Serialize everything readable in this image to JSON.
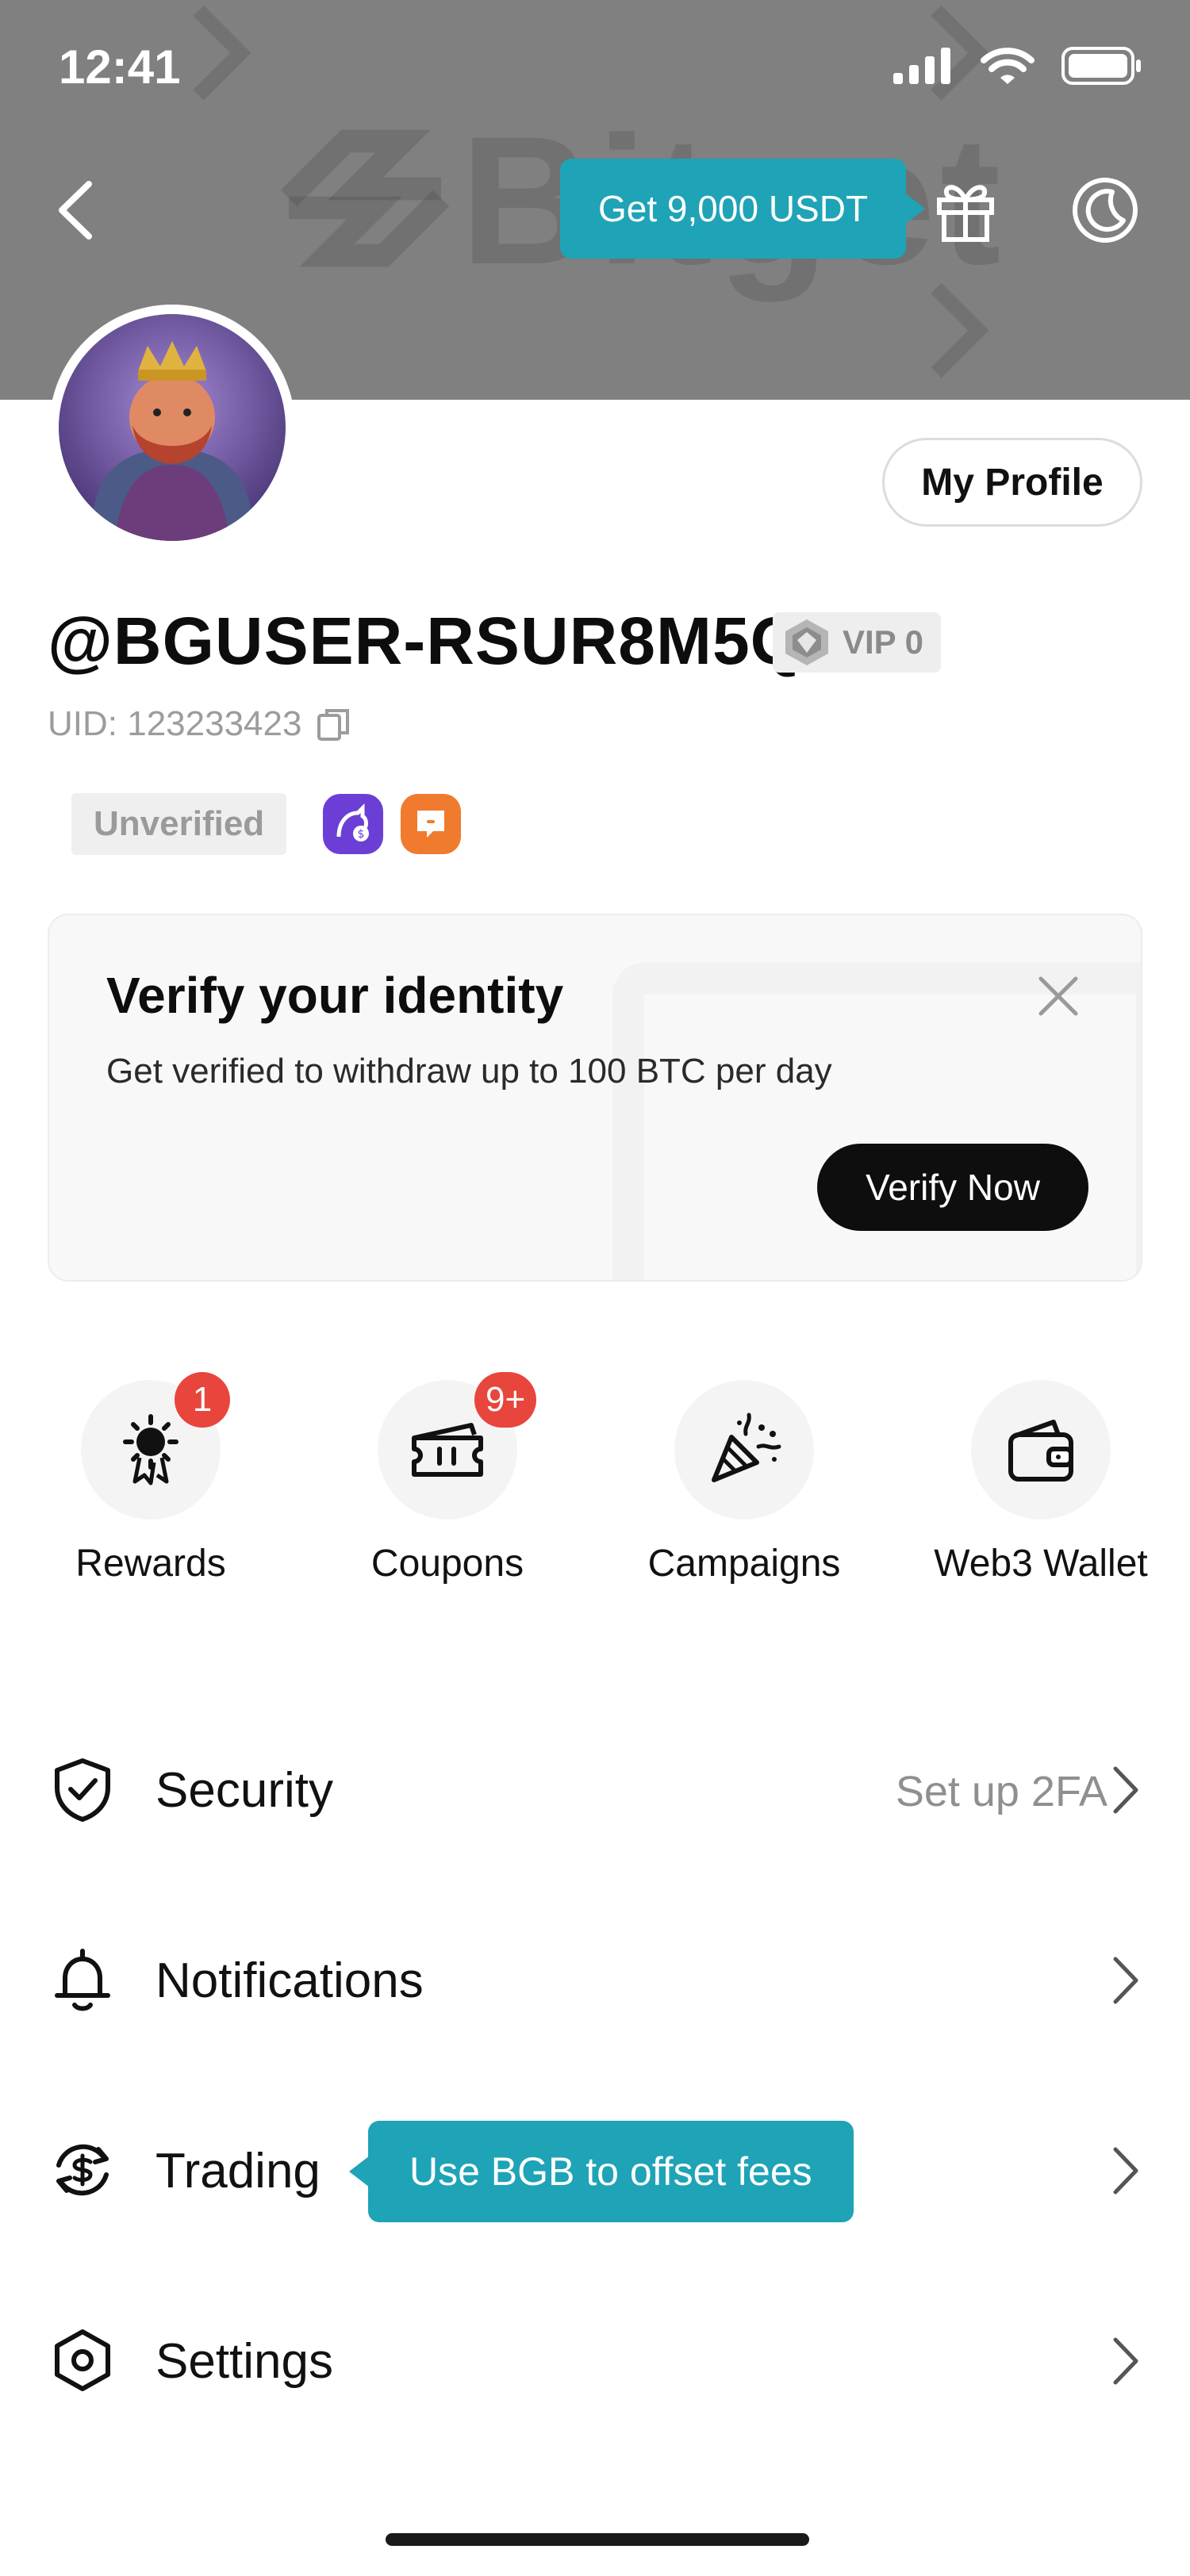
{
  "status_bar": {
    "time": "12:41"
  },
  "header": {
    "promo_label": "Get 9,000 USDT",
    "watermark_text": "Bitget"
  },
  "profile": {
    "my_profile_label": "My Profile",
    "username": "@BGUSER-RSUR8M5Q",
    "vip_label": "VIP 0",
    "uid": "UID: 123233423",
    "verification_status": "Unverified"
  },
  "verify_card": {
    "title": "Verify your identity",
    "subtitle": "Get verified to withdraw up to 100 BTC per day",
    "button_label": "Verify Now"
  },
  "quick_actions": [
    {
      "label": "Rewards",
      "badge": "1",
      "icon": "rewards-medal-icon"
    },
    {
      "label": "Coupons",
      "badge": "9+",
      "icon": "coupon-ticket-icon"
    },
    {
      "label": "Campaigns",
      "badge": "",
      "icon": "party-popper-icon"
    },
    {
      "label": "Web3 Wallet",
      "badge": "",
      "icon": "wallet-icon"
    }
  ],
  "menu": [
    {
      "label": "Security",
      "right_text": "Set up 2FA",
      "icon": "shield-check-icon"
    },
    {
      "label": "Notifications",
      "right_text": "",
      "icon": "bell-icon"
    },
    {
      "label": "Trading",
      "tooltip": "Use BGB to offset fees",
      "icon": "dollar-cycle-icon"
    },
    {
      "label": "Settings",
      "right_text": "",
      "icon": "hexagon-settings-icon"
    }
  ],
  "colors": {
    "header_bg": "#808080",
    "accent_teal": "#1fa3b6",
    "badge_red": "#e8453c",
    "primary_button": "#0e0e0e"
  }
}
